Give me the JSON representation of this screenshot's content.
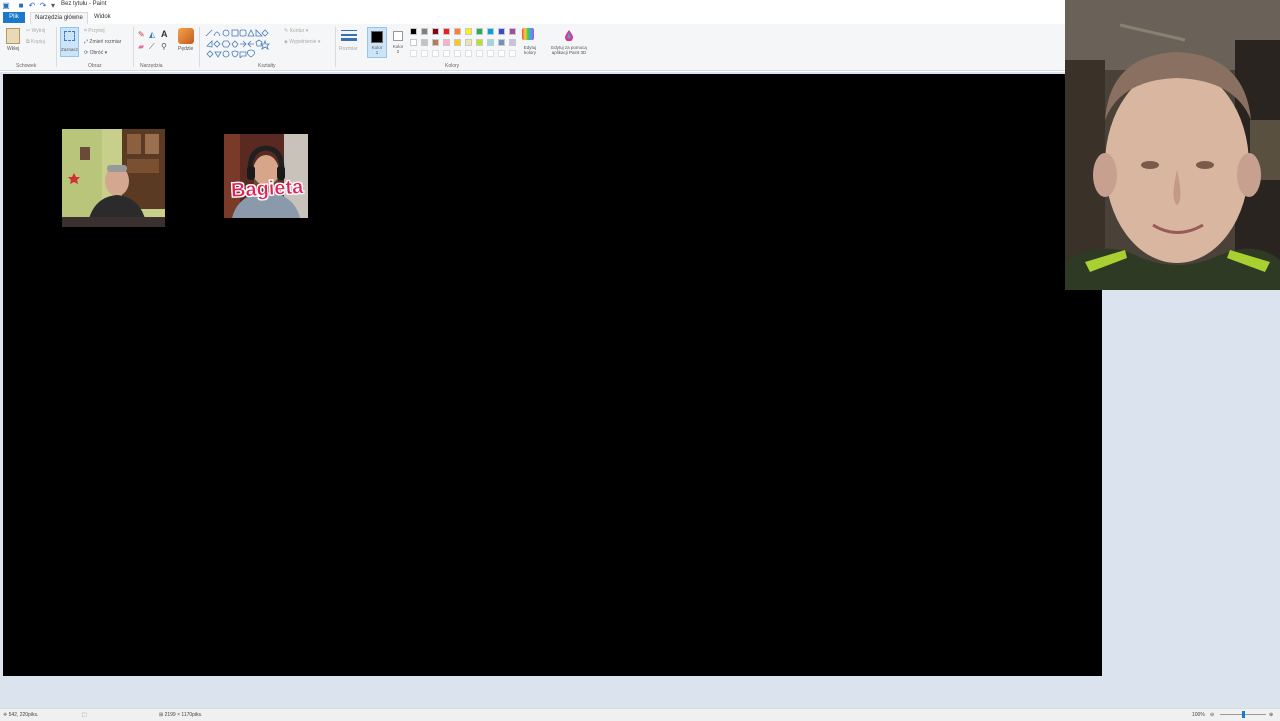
{
  "window": {
    "title": "Bez tytułu - Paint"
  },
  "tabs": {
    "file": "Plik",
    "home": "Narzędzia główne",
    "view": "Widok"
  },
  "ribbon": {
    "clipboard": {
      "paste": "Wklej",
      "cut": "Wytnij",
      "copy": "Kopiuj",
      "label": "Schowek"
    },
    "image": {
      "select": "Zaznacz",
      "crop": "Przytnij",
      "resize": "Zmień rozmiar",
      "rotate": "Obróć",
      "label": "Obraz"
    },
    "tools": {
      "label": "Narzędzia"
    },
    "brushes": {
      "label": "Pędzle"
    },
    "shapes": {
      "outline": "Kontur",
      "fill": "Wypełnienie",
      "label": "Kształty"
    },
    "size": {
      "label": "Rozmiar"
    },
    "colors": {
      "color1": "Kolor 1",
      "color2": "Kolor 2",
      "edit_colors": "Edytuj kolory",
      "paint3d": "Edytuj za pomocą aplikacji Paint 3D",
      "label": "Kolory",
      "color1_value": "#000000",
      "color2_value": "#ffffff",
      "palette_row1": [
        "#000000",
        "#7f7f7f",
        "#880015",
        "#ed1c24",
        "#ff7f27",
        "#fff200",
        "#22b14c",
        "#00a2e8",
        "#3f48cc",
        "#a349a4"
      ],
      "palette_row2": [
        "#ffffff",
        "#c3c3c3",
        "#b97a57",
        "#ffaec9",
        "#ffc90e",
        "#efe4b0",
        "#b5e61d",
        "#99d9ea",
        "#7092be",
        "#c8bfe7"
      ]
    }
  },
  "canvas": {
    "background": "#000000",
    "sticker_text": "Bagieta",
    "sticker_color": "#e31f56"
  },
  "statusbar": {
    "cursor_position": "542, 220piks.",
    "canvas_size": "2199 × 1170piks.",
    "zoom": "100%"
  }
}
